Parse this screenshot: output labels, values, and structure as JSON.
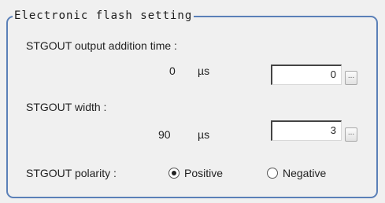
{
  "group": {
    "title": "Electronic flash setting"
  },
  "addition_time": {
    "label": "STGOUT output addition time :",
    "value": "0",
    "unit": "µs",
    "input_value": "0",
    "button_label": "..."
  },
  "width": {
    "label": "STGOUT width :",
    "value": "90",
    "unit": "µs",
    "input_value": "3",
    "button_label": "..."
  },
  "polarity": {
    "label": "STGOUT polarity :",
    "options": [
      {
        "label": "Positive",
        "selected": true
      },
      {
        "label": "Negative",
        "selected": false
      }
    ]
  }
}
